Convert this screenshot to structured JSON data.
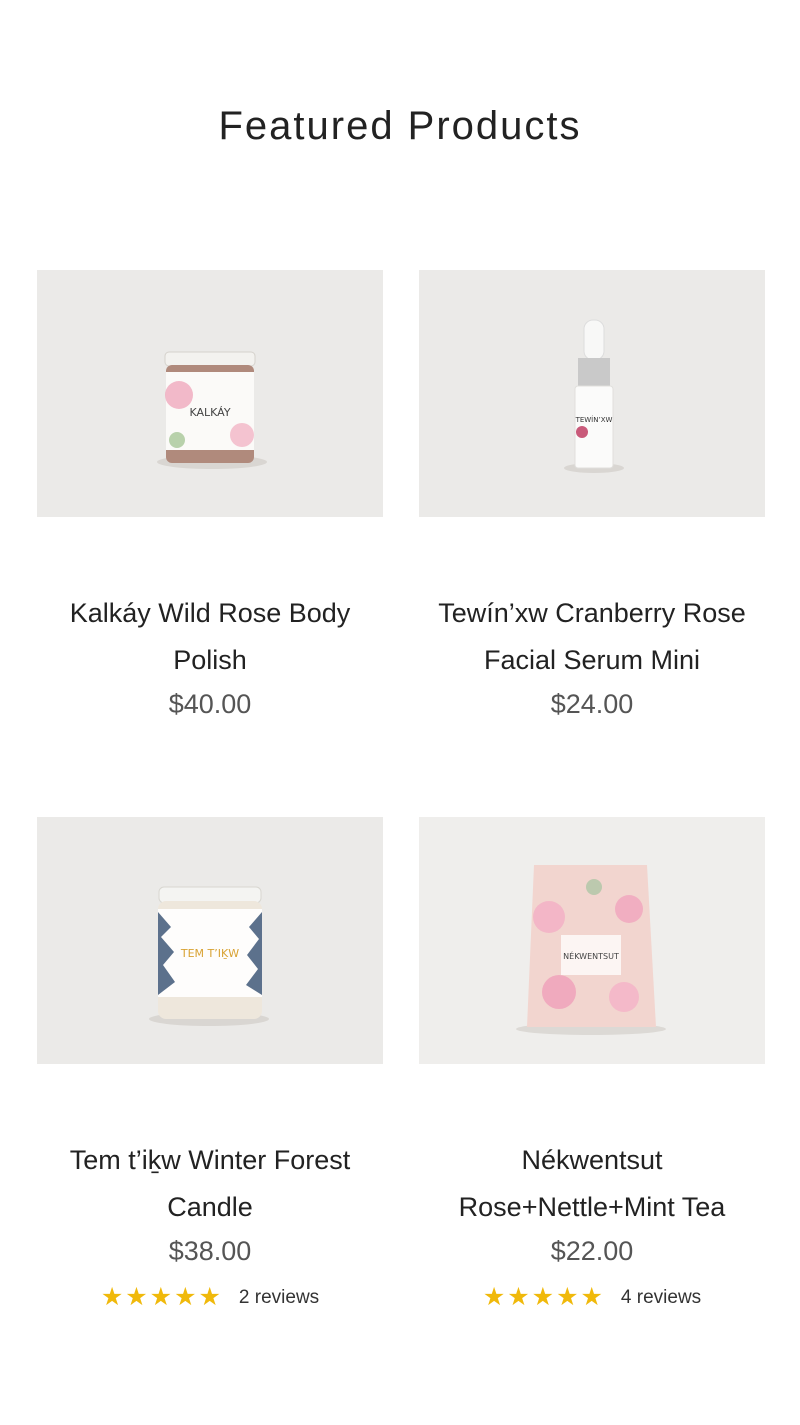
{
  "section": {
    "title": "Featured Products"
  },
  "products": [
    {
      "name_line1": "Kalkáy Wild Rose Body",
      "name_line2": "Polish",
      "price": "$40.00",
      "jar_label": "KALKÁY"
    },
    {
      "name_line1": "Tewín’xw Cranberry Rose",
      "name_line2": "Facial Serum Mini",
      "price": "$24.00",
      "bottle_label": "TEWÍN’XW"
    },
    {
      "name_line1": "Tem t’iḵw Winter Forest",
      "name_line2": "Candle",
      "price": "$38.00",
      "rating": 5,
      "reviews": "2 reviews",
      "candle_label": "TEM T’IḴW"
    },
    {
      "name_line1": "Nékwentsut",
      "name_line2": "Rose+Nettle+Mint Tea",
      "price": "$22.00",
      "rating": 5,
      "reviews": "4 reviews",
      "pouch_label": "NÉKWENTSUT"
    }
  ],
  "colors": {
    "star": "#f0b90b",
    "price": "#555555",
    "image_bg": "#e9e8e6"
  }
}
